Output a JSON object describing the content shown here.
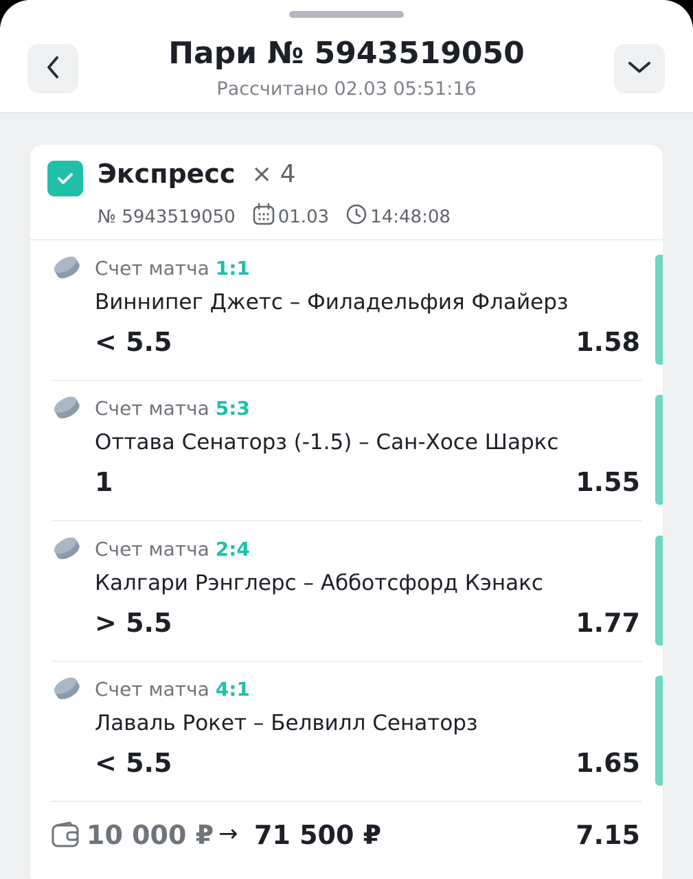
{
  "header": {
    "title": "Пари № 5943519050",
    "subtitle": "Рассчитано 02.03 05:51:16"
  },
  "bet": {
    "type": "Экспресс",
    "multiplier": "× 4",
    "number": "№ 5943519050",
    "date": "01.03",
    "time": "14:48:08",
    "selections": [
      {
        "score_label": "Счет матча",
        "score": "1:1",
        "match": "Виннипег Джетс – Филадельфия Флайерз",
        "outcome": "< 5.5",
        "odds": "1.58",
        "sport_icon": "hockey-puck-icon"
      },
      {
        "score_label": "Счет матча",
        "score": "5:3",
        "match": "Оттава Сенаторз (-1.5) – Сан-Хосе Шаркс",
        "outcome": "1",
        "odds": "1.55",
        "sport_icon": "hockey-puck-icon"
      },
      {
        "score_label": "Счет матча",
        "score": "2:4",
        "match": "Калгари Рэнглерс – Абботсфорд Кэнакс",
        "outcome": "> 5.5",
        "odds": "1.77",
        "sport_icon": "hockey-puck-icon"
      },
      {
        "score_label": "Счет матча",
        "score": "4:1",
        "match": "Лаваль Рокет – Белвилл Сенаторз",
        "outcome": "< 5.5",
        "odds": "1.65",
        "sport_icon": "hockey-puck-icon"
      }
    ],
    "stake": "10 000 ₽",
    "arrow": "→",
    "payout": "71 500 ₽",
    "total_odds": "7.15"
  },
  "colors": {
    "accent": "#1fbfa8",
    "win_bar": "#6fd6c4",
    "background": "#eef0f2"
  }
}
